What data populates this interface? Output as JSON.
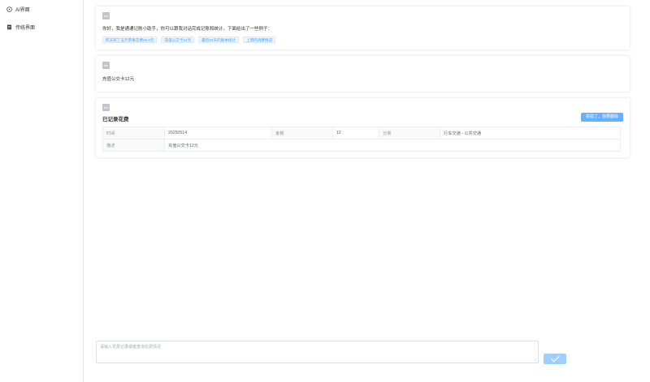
{
  "sidebar": {
    "items": [
      {
        "label": "AI界面",
        "icon": "chat-circle-icon"
      },
      {
        "label": "传统界面",
        "icon": "table-icon"
      }
    ]
  },
  "messages": {
    "bot_greeting": {
      "avatar": "bot",
      "text": "你好，我是通通记账小助手，你可以跟我对话完成记账和统计。下面给出了一些例子：",
      "examples": [
        "昨天买了五斤苹果花费20.5元",
        "充值公交卡12元",
        "最近10天的账本统计",
        "上周的消费情况"
      ]
    },
    "user_message": {
      "avatar": "Me",
      "text": "充值公交卡12元"
    },
    "bot_record": {
      "avatar": "bot",
      "title": "已记录花费",
      "undo_label": "搞错了，我要删除",
      "rows": {
        "time_label": "时间",
        "time_value": "20250514",
        "amount_label": "金额",
        "amount_value": "12",
        "category_label": "分类",
        "category_value": "行车交通 - 公共交通",
        "desc_label": "描述",
        "desc_value": "充值公交卡12元"
      }
    }
  },
  "composer": {
    "placeholder": "请输入花费记录或者查询花费情况"
  },
  "colors": {
    "accent": "#409eff",
    "send_button": "#a0cfff",
    "undo_button": "#66b1ff"
  }
}
